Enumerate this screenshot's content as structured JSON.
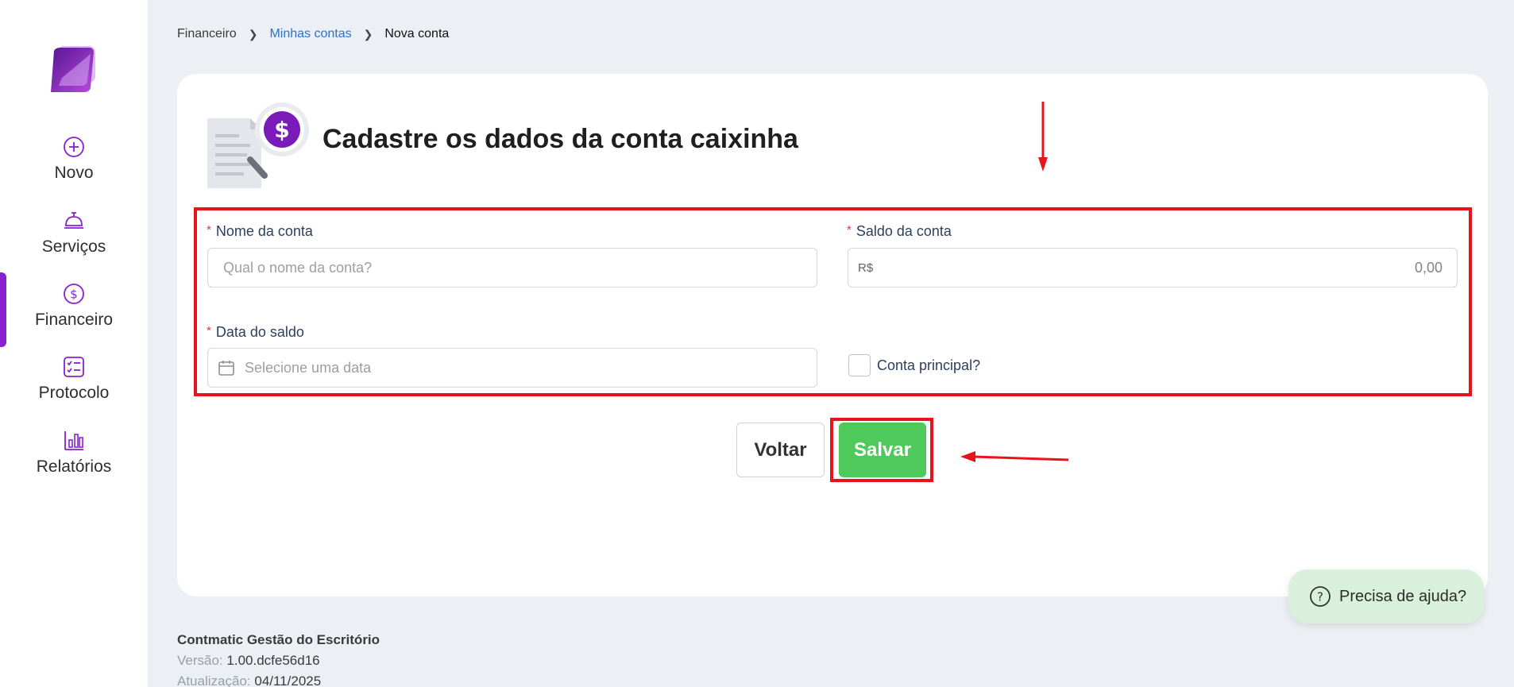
{
  "sidebar": {
    "items": [
      {
        "label": "Novo",
        "icon": "plus-circle-icon"
      },
      {
        "label": "Serviços",
        "icon": "bell-icon"
      },
      {
        "label": "Financeiro",
        "icon": "dollar-circle-icon",
        "active": true
      },
      {
        "label": "Protocolo",
        "icon": "checklist-icon"
      },
      {
        "label": "Relatórios",
        "icon": "bar-chart-icon"
      }
    ],
    "accent": "#8a1fd0"
  },
  "breadcrumb": {
    "root": "Financeiro",
    "parent": "Minhas contas",
    "current": "Nova conta"
  },
  "page": {
    "title": "Cadastre os dados da conta caixinha"
  },
  "form": {
    "nome": {
      "label": "Nome da conta",
      "placeholder": "Qual o nome da conta?"
    },
    "saldo": {
      "label": "Saldo da conta",
      "prefix": "R$",
      "value": "0,00"
    },
    "data": {
      "label": "Data do saldo",
      "placeholder": "Selecione uma data"
    },
    "principal": {
      "label": "Conta principal?",
      "checked": false
    },
    "required_mark": "*"
  },
  "actions": {
    "back_label": "Voltar",
    "save_label": "Salvar",
    "save_color": "#4ec95c"
  },
  "footer": {
    "brand": "Contmatic Gestão do Escritório",
    "version_label": "Versão:",
    "version_value": "1.00.dcfe56d16",
    "update_label": "Atualização:",
    "update_value": "04/11/2025"
  },
  "help": {
    "label": "Precisa de ajuda?",
    "icon": "question-circle-icon"
  },
  "annotation_color": "#e8141b"
}
